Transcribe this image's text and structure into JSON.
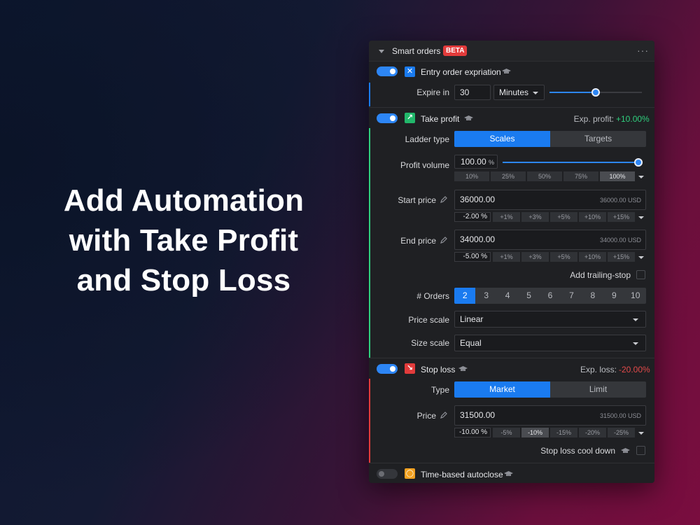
{
  "headline": {
    "line1": "Add Automation",
    "line2": "with Take Profit",
    "line3": "and Stop Loss"
  },
  "panel": {
    "title": "Smart orders",
    "badge": "BETA",
    "menu_icon": "ellipsis-icon",
    "more": "···"
  },
  "entry_expiration": {
    "enabled": true,
    "title": "Entry order expriation",
    "icon": "x-square-icon",
    "icon_glyph": "✕",
    "expire_label": "Expire in",
    "expire_value": "30",
    "unit": "Minutes",
    "slider_level": 0.5
  },
  "take_profit": {
    "enabled": true,
    "title": "Take profit",
    "icon": "arrow-up-right-icon",
    "icon_glyph": "↗",
    "exp_label": "Exp. profit:",
    "exp_value": "+10.00%",
    "ladder_label": "Ladder type",
    "ladder_options": [
      "Scales",
      "Targets"
    ],
    "ladder_active": "Scales",
    "volume_label": "Profit volume",
    "volume_value": "100.00",
    "volume_unit": "%",
    "volume_level": 1.0,
    "volume_chips": [
      "10%",
      "25%",
      "50%",
      "75%",
      "100%"
    ],
    "volume_chip_active": "100%",
    "start_label": "Start price",
    "start_value": "36000.00",
    "start_hint": "36000.00 USD",
    "start_pct": "-2.00",
    "end_label": "End price",
    "end_value": "34000.00",
    "end_hint": "34000.00 USD",
    "end_pct": "-5.00",
    "pct_unit": "%",
    "price_chips": [
      "+1%",
      "+3%",
      "+5%",
      "+10%",
      "+15%"
    ],
    "trailing_label": "Add trailing-stop",
    "orders_label": "# Orders",
    "orders_options": [
      "2",
      "3",
      "4",
      "5",
      "6",
      "7",
      "8",
      "9",
      "10"
    ],
    "orders_active": "2",
    "price_scale_label": "Price scale",
    "price_scale_value": "Linear",
    "size_scale_label": "Size scale",
    "size_scale_value": "Equal"
  },
  "stop_loss": {
    "enabled": true,
    "title": "Stop loss",
    "icon": "arrow-down-right-icon",
    "icon_glyph": "↘",
    "exp_label": "Exp. loss:",
    "exp_value": "-20.00%",
    "type_label": "Type",
    "type_options": [
      "Market",
      "Limit"
    ],
    "type_active": "Market",
    "price_label": "Price",
    "price_value": "31500.00",
    "price_hint": "31500.00 USD",
    "price_pct": "-10.00",
    "pct_unit": "%",
    "price_chips": [
      "-5%",
      "-10%",
      "-15%",
      "-20%",
      "-25%"
    ],
    "price_chip_active": "-10%",
    "cooldown_label": "Stop loss cool down"
  },
  "time_autoclose": {
    "enabled": false,
    "title": "Time-based autoclose",
    "icon": "clock-icon",
    "icon_glyph": "◯"
  },
  "colors": {
    "accent": "#1a7bf0",
    "profit": "#2fcf7d",
    "loss": "#e23b3b",
    "autoclose": "#f0a020"
  }
}
